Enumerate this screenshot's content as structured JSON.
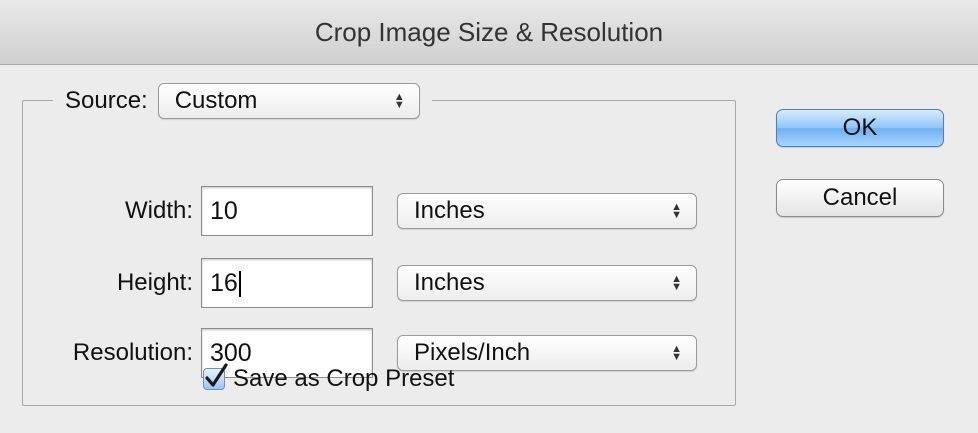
{
  "window": {
    "title": "Crop Image Size & Resolution"
  },
  "source": {
    "label": "Source:",
    "value": "Custom"
  },
  "width": {
    "label": "Width:",
    "value": "10",
    "unit": "Inches"
  },
  "height": {
    "label": "Height:",
    "value": "16",
    "unit": "Inches"
  },
  "resolution": {
    "label": "Resolution:",
    "value": "300",
    "unit": "Pixels/Inch"
  },
  "save_preset": {
    "label": "Save as Crop Preset",
    "checked": true
  },
  "buttons": {
    "ok": "OK",
    "cancel": "Cancel"
  },
  "icons": {
    "popup_arrows": "up-down-arrows-icon",
    "checkbox_check": "checkmark-icon"
  },
  "colors": {
    "default_button": "#7ab8f5",
    "checkbox": "#9fc2f0"
  }
}
